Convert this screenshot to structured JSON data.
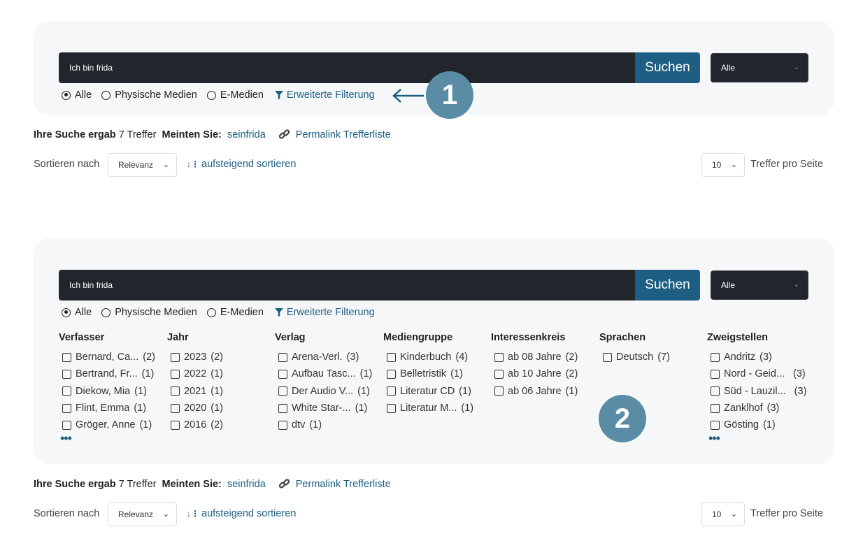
{
  "search": {
    "value": "Ich bin frida",
    "button_label": "Suchen",
    "scope_selected": "Alle"
  },
  "radios": [
    {
      "label": "Alle",
      "checked": true
    },
    {
      "label": "Physische Medien",
      "checked": false
    },
    {
      "label": "E-Medien",
      "checked": false
    }
  ],
  "advanced_filter_label": "Erweiterte Filterung",
  "callouts": {
    "first": "1",
    "second": "2"
  },
  "results": {
    "prefix": "Ihre Suche ergab",
    "count_text": "7 Treffer",
    "suggest_label": "Meinten Sie:",
    "suggest_link": "seinfrida",
    "permalink_label": "Permalink Trefferliste"
  },
  "sorting": {
    "label": "Sortieren nach",
    "selected": "Relevanz",
    "direction_label": "aufsteigend sortieren",
    "per_page_value": "10",
    "per_page_label": "Treffer pro Seite"
  },
  "facets": [
    {
      "title": "Verfasser",
      "items": [
        {
          "label": "Bernard, Ca...",
          "count": "(2)"
        },
        {
          "label": "Bertrand, Fr...",
          "count": "(1)"
        },
        {
          "label": "Diekow, Mia",
          "count": "(1)"
        },
        {
          "label": "Flint, Emma",
          "count": "(1)"
        },
        {
          "label": "Gröger, Anne",
          "count": "(1)"
        }
      ],
      "more": "•••"
    },
    {
      "title": "Jahr",
      "items": [
        {
          "label": "2023",
          "count": "(2)"
        },
        {
          "label": "2022",
          "count": "(1)"
        },
        {
          "label": "2021",
          "count": "(1)"
        },
        {
          "label": "2020",
          "count": "(1)"
        },
        {
          "label": "2016",
          "count": "(2)"
        }
      ],
      "more": ""
    },
    {
      "title": "Verlag",
      "items": [
        {
          "label": "Arena-Verl.",
          "count": "(3)"
        },
        {
          "label": "Aufbau Tasc...",
          "count": "(1)"
        },
        {
          "label": "Der Audio V...",
          "count": "(1)"
        },
        {
          "label": "White Star-...",
          "count": "(1)"
        },
        {
          "label": "dtv",
          "count": "(1)"
        }
      ],
      "more": ""
    },
    {
      "title": "Mediengruppe",
      "items": [
        {
          "label": "Kinderbuch",
          "count": "(4)"
        },
        {
          "label": "Belletristik",
          "count": "(1)"
        },
        {
          "label": "Literatur CD",
          "count": "(1)"
        },
        {
          "label": "Literatur M...",
          "count": "(1)"
        }
      ],
      "more": ""
    },
    {
      "title": "Interessenkreis",
      "items": [
        {
          "label": "ab 08 Jahre",
          "count": "(2)"
        },
        {
          "label": "ab 10 Jahre",
          "count": "(2)"
        },
        {
          "label": "ab 06 Jahre",
          "count": "(1)"
        }
      ],
      "more": ""
    },
    {
      "title": "Sprachen",
      "items": [
        {
          "label": "Deutsch",
          "count": "(7)"
        }
      ],
      "more": ""
    },
    {
      "title": "Zweigstellen",
      "items": [
        {
          "label": "Andritz",
          "count": "(3)"
        },
        {
          "label": "Nord - Geid...",
          "count": "(3)"
        },
        {
          "label": "Süd - Lauzil...",
          "count": "(3)"
        },
        {
          "label": "Zanklhof",
          "count": "(3)"
        },
        {
          "label": "Gösting",
          "count": "(1)"
        }
      ],
      "more": "•••"
    }
  ],
  "colors": {
    "accent": "#1d5e82",
    "search_bg": "#21262d",
    "panel_bg": "#f5f7f9",
    "callout": "#5a8ca6"
  }
}
